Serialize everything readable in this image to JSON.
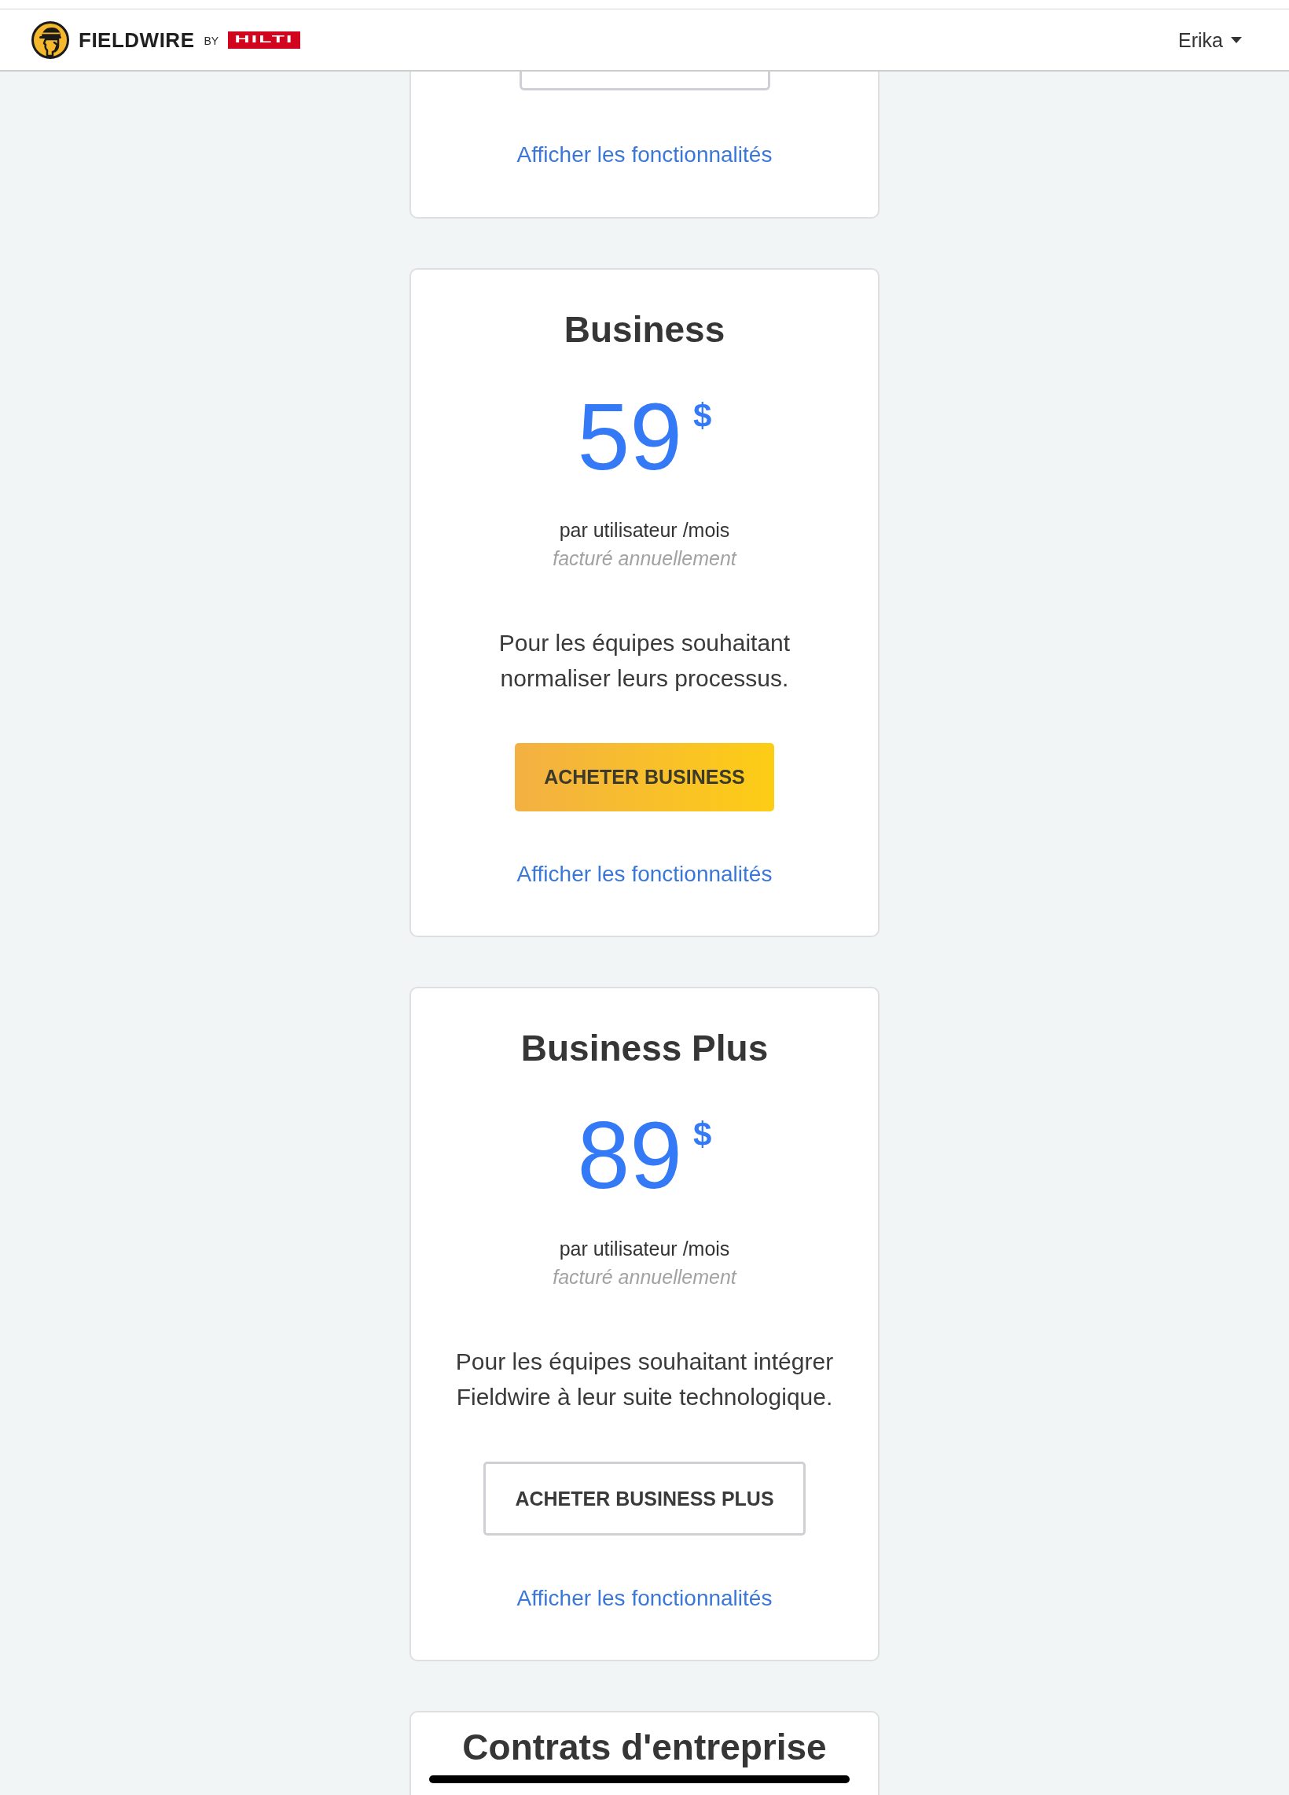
{
  "header": {
    "brand": "FIELDWIRE",
    "by": "BY",
    "partner": "HILTI",
    "user": "Erika"
  },
  "plans": [
    {
      "kind": "cut_top",
      "link": "Afficher les fonctionnalités"
    },
    {
      "kind": "full",
      "name": "Business",
      "price": "59",
      "currency": "$",
      "period": "par utilisateur /mois",
      "billing": "facturé annuellement",
      "description": "Pour les équipes souhaitant\nnormaliser leurs processus.",
      "button": {
        "kind": "filled",
        "label": "ACHETER BUSINESS"
      },
      "link": "Afficher les fonctionnalités"
    },
    {
      "kind": "full",
      "name": "Business Plus",
      "price": "89",
      "currency": "$",
      "period": "par utilisateur /mois",
      "billing": "facturé annuellement",
      "description": "Pour les équipes souhaitant intégrer\nFieldwire à leur suite technologique.",
      "button": {
        "kind": "outlined",
        "label": "ACHETER BUSINESS PLUS"
      },
      "link": "Afficher les fonctionnalités"
    },
    {
      "kind": "cut_bottom",
      "name": "Contrats d'entreprise"
    }
  ]
}
